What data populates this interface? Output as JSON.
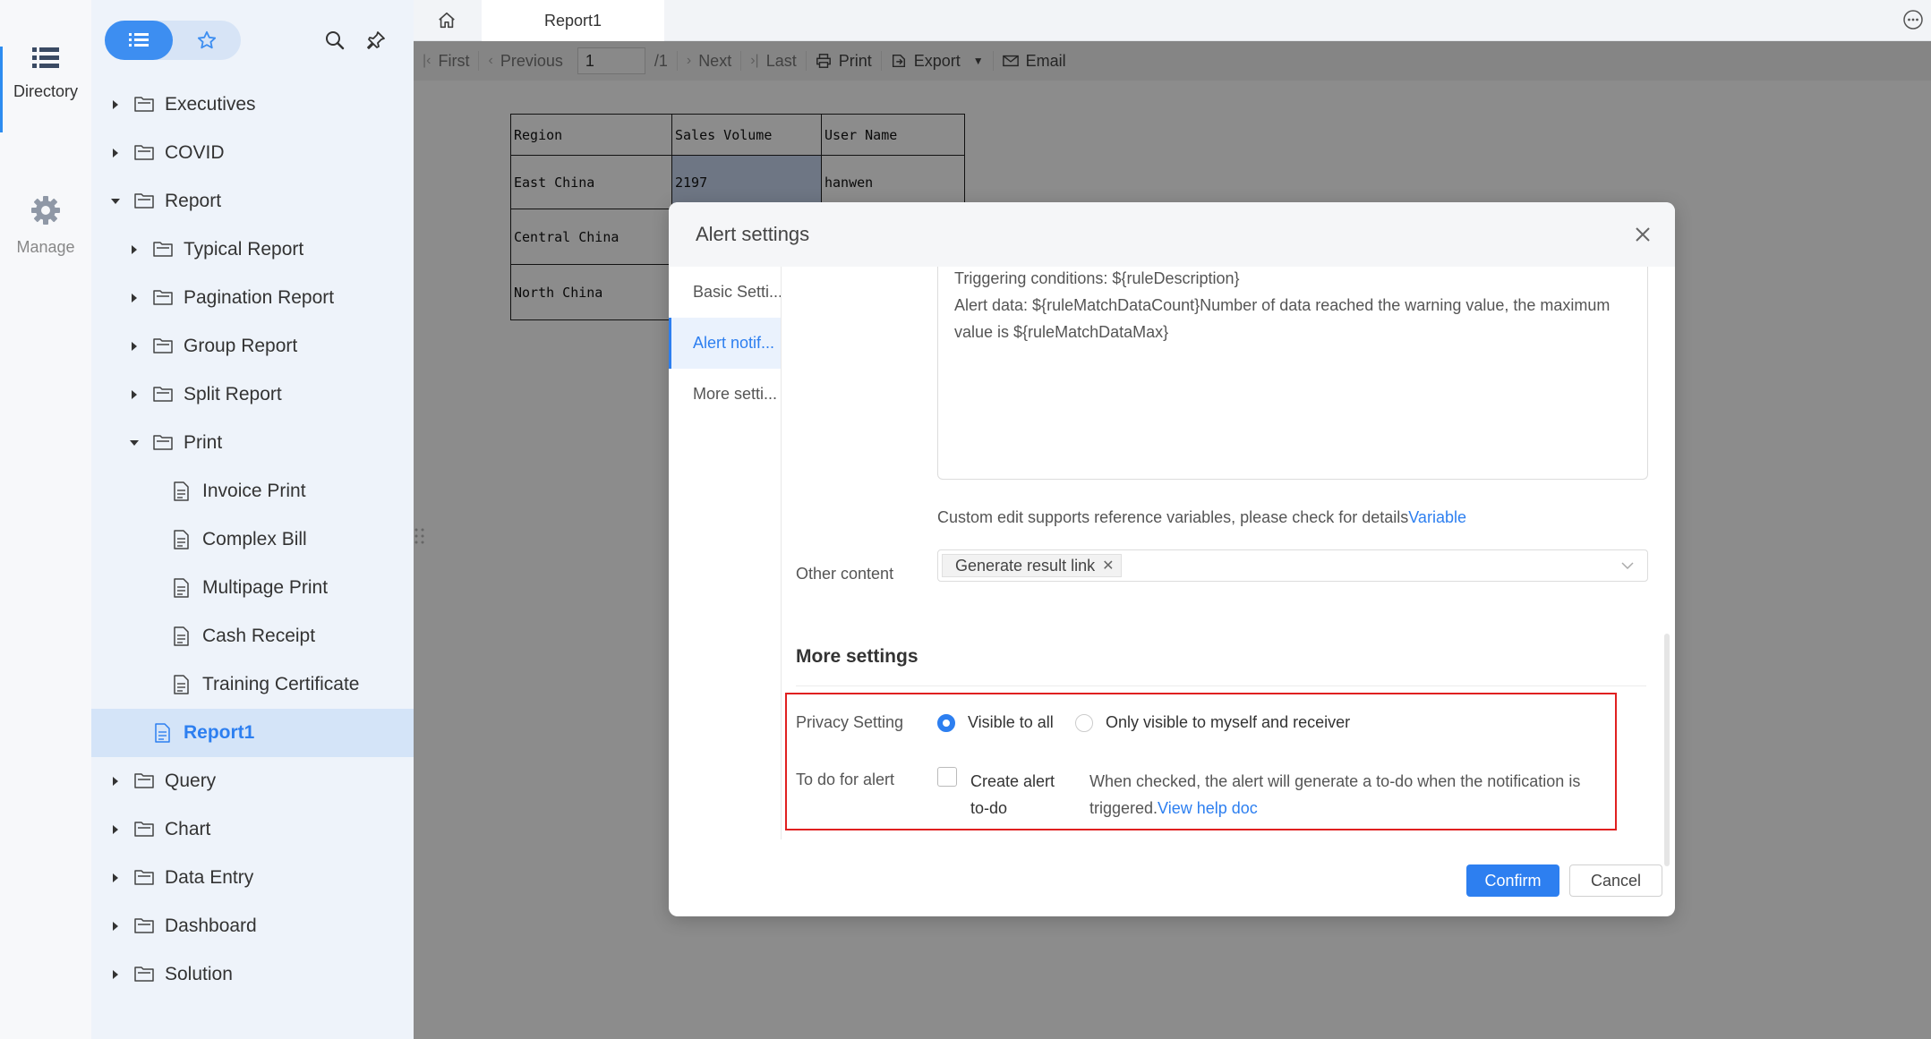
{
  "rail": {
    "directory_label": "Directory",
    "manage_label": "Manage"
  },
  "sidebar": {
    "tree": [
      {
        "label": "Executives",
        "type": "folder",
        "level": 0,
        "expanded": false
      },
      {
        "label": "COVID",
        "type": "folder",
        "level": 0,
        "expanded": false
      },
      {
        "label": "Report",
        "type": "folder",
        "level": 0,
        "expanded": true
      },
      {
        "label": "Typical Report",
        "type": "folder",
        "level": 1,
        "expanded": false
      },
      {
        "label": "Pagination Report",
        "type": "folder",
        "level": 1,
        "expanded": false
      },
      {
        "label": "Group Report",
        "type": "folder",
        "level": 1,
        "expanded": false
      },
      {
        "label": "Split Report",
        "type": "folder",
        "level": 1,
        "expanded": false
      },
      {
        "label": "Print",
        "type": "folder",
        "level": 1,
        "expanded": true
      },
      {
        "label": "Invoice Print",
        "type": "file",
        "level": 2
      },
      {
        "label": "Complex Bill",
        "type": "file",
        "level": 2
      },
      {
        "label": "Multipage Print",
        "type": "file",
        "level": 2
      },
      {
        "label": "Cash Receipt",
        "type": "file",
        "level": 2
      },
      {
        "label": "Training Certificate",
        "type": "file",
        "level": 2
      },
      {
        "label": "Report1",
        "type": "file",
        "level": 1,
        "selected": true
      },
      {
        "label": "Query",
        "type": "folder",
        "level": 0,
        "expanded": false
      },
      {
        "label": "Chart",
        "type": "folder",
        "level": 0,
        "expanded": false
      },
      {
        "label": "Data Entry",
        "type": "folder",
        "level": 0,
        "expanded": false
      },
      {
        "label": "Dashboard",
        "type": "folder",
        "level": 0,
        "expanded": false
      },
      {
        "label": "Solution",
        "type": "folder",
        "level": 0,
        "expanded": false
      }
    ]
  },
  "tabs": {
    "active_tab": "Report1"
  },
  "toolbar": {
    "first": "First",
    "previous": "Previous",
    "page_value": "1",
    "page_total": "/1",
    "next": "Next",
    "last": "Last",
    "print": "Print",
    "export": "Export",
    "email": "Email"
  },
  "report_table": {
    "headers": [
      "Region",
      "Sales Volume",
      "User Name"
    ],
    "rows": [
      [
        "East China",
        "2197",
        "hanwen"
      ],
      [
        "Central China",
        "",
        ""
      ],
      [
        "North China",
        "",
        ""
      ]
    ]
  },
  "modal": {
    "title": "Alert settings",
    "nav": [
      "Basic Setti...",
      "Alert notif...",
      "More setti..."
    ],
    "active_nav": 1,
    "content_lines": [
      "Triggering conditions: ${ruleDescription}",
      "Alert data: ${ruleMatchDataCount}Number of data reached the warning value, the maximum",
      "value is ${ruleMatchDataMax}"
    ],
    "hint_text": "Custom edit supports reference variables, please check for details",
    "hint_link": "Variable",
    "other_content_label": "Other content",
    "other_content_tag": "Generate result link",
    "more_settings_title": "More settings",
    "privacy_label": "Privacy Setting",
    "privacy_option_1": "Visible to all",
    "privacy_option_2": "Only visible to myself and receiver",
    "privacy_selected": "Visible to all",
    "todo_label": "To do for alert",
    "todo_checkbox_label": "Create alert to-do",
    "todo_checked": false,
    "todo_desc": "When checked, the alert will generate a to-do when the notification is triggered.",
    "todo_link": "View help doc",
    "confirm": "Confirm",
    "cancel": "Cancel"
  },
  "colors": {
    "accent": "#2d7ff0",
    "highlight_box": "#e02020",
    "sidebar_bg": "#eef3fa"
  }
}
